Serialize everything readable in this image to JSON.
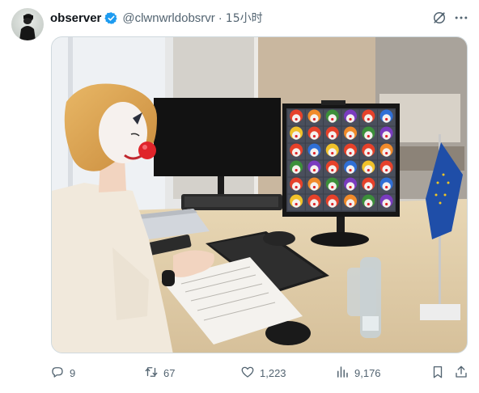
{
  "post": {
    "display_name": "observer",
    "handle": "@clwnwrldobsrvr",
    "separator": "·",
    "time": "15小时"
  },
  "icons": {
    "verified": "verified-badge-icon",
    "grok": "grok-icon",
    "more": "more-icon",
    "reply": "reply-icon",
    "retweet": "retweet-icon",
    "like": "like-icon",
    "views": "views-icon",
    "bookmark": "bookmark-icon",
    "share": "share-icon"
  },
  "stats": {
    "replies": "9",
    "retweets": "67",
    "likes": "1,223",
    "views": "9,176"
  },
  "colors": {
    "verified": "#1d9bf0",
    "text": "#0f1419",
    "secondary": "#536471",
    "clown_nose": "#e0242a"
  }
}
